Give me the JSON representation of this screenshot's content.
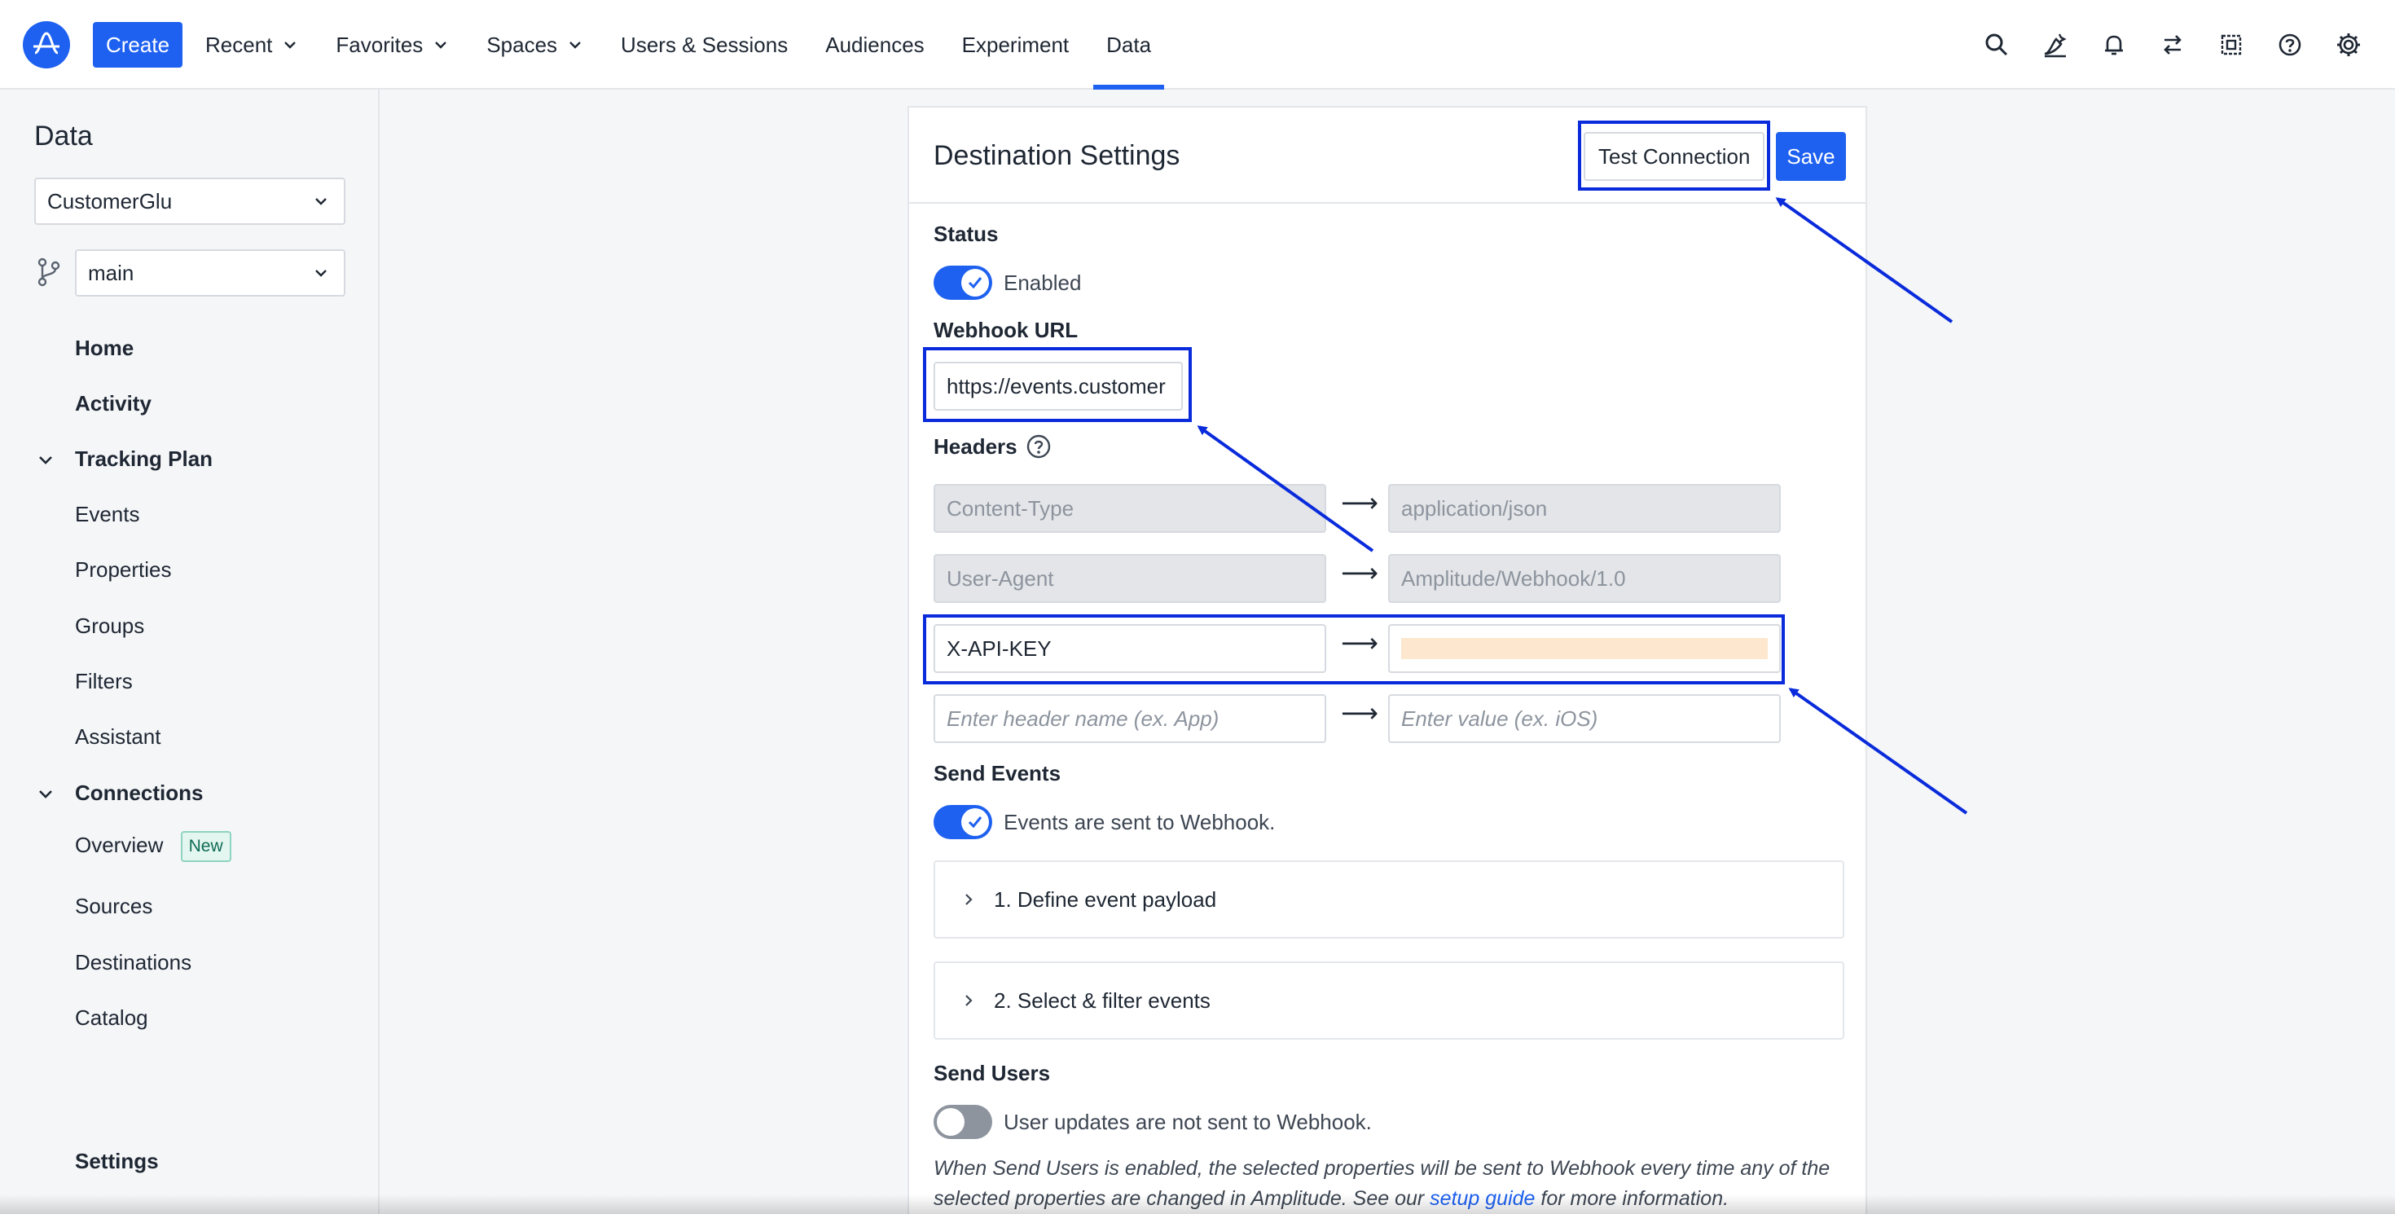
{
  "topnav": {
    "create_label": "Create",
    "items": [
      {
        "label": "Recent",
        "dropdown": true
      },
      {
        "label": "Favorites",
        "dropdown": true
      },
      {
        "label": "Spaces",
        "dropdown": true
      },
      {
        "label": "Users & Sessions",
        "dropdown": false
      },
      {
        "label": "Audiences",
        "dropdown": false
      },
      {
        "label": "Experiment",
        "dropdown": false
      },
      {
        "label": "Data",
        "dropdown": false,
        "active": true
      }
    ],
    "icons": [
      "search-icon",
      "ai-assistant-icon",
      "bell-icon",
      "switch-icon",
      "apps-icon",
      "help-icon",
      "gear-icon"
    ]
  },
  "sidebar": {
    "title": "Data",
    "project_select": "CustomerGlu",
    "branch_select": "main",
    "items": {
      "home": "Home",
      "activity": "Activity",
      "tracking_plan": "Tracking Plan",
      "events": "Events",
      "properties": "Properties",
      "groups": "Groups",
      "filters": "Filters",
      "assistant": "Assistant",
      "connections": "Connections",
      "overview": "Overview",
      "overview_badge": "New",
      "sources": "Sources",
      "destinations": "Destinations",
      "catalog": "Catalog",
      "settings": "Settings"
    }
  },
  "destination": {
    "title": "Destination Settings",
    "test_connection_label": "Test Connection",
    "save_label": "Save",
    "status_label": "Status",
    "status_toggle_text": "Enabled",
    "webhook_url_label": "Webhook URL",
    "webhook_url_value": "https://events.customer",
    "headers_label": "Headers",
    "headers": [
      {
        "name": "Content-Type",
        "value": "application/json"
      },
      {
        "name": "User-Agent",
        "value": "Amplitude/Webhook/1.0"
      },
      {
        "name": "X-API-KEY",
        "value": ""
      }
    ],
    "header_name_placeholder": "Enter header name (ex. App)",
    "header_value_placeholder": "Enter value (ex. iOS)",
    "arrow_glyph": "⟶",
    "send_events_label": "Send Events",
    "send_events_text": "Events are sent to Webhook.",
    "accordion_1": "1. Define event payload",
    "accordion_2": "2. Select & filter events",
    "send_users_label": "Send Users",
    "send_users_text": "User updates are not sent to Webhook.",
    "note_before": "When Send Users is enabled, the selected properties will be sent to Webhook every time any of the selected properties are changed in Amplitude. See our ",
    "note_link": "setup guide",
    "note_after": " for more information."
  },
  "colors": {
    "accent": "#1e61f0",
    "annotation": "#0a2bdb",
    "redacted_fill": "#fde7cf"
  }
}
